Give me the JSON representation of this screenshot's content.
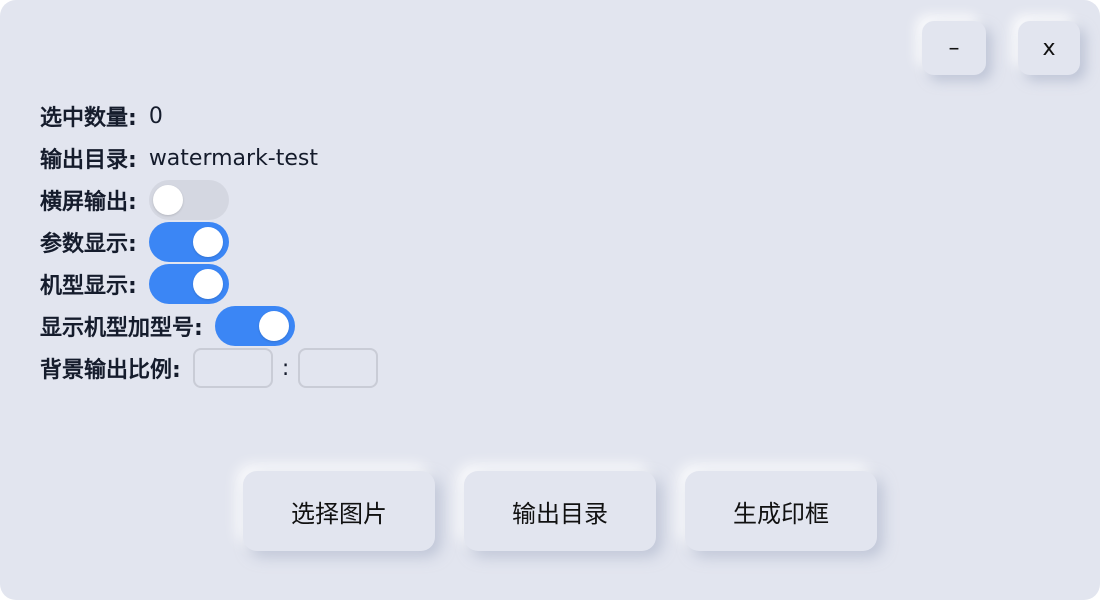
{
  "window_controls": {
    "minimize_label": "–",
    "close_label": "x"
  },
  "settings": {
    "selected_count": {
      "label": "选中数量:",
      "value": "0"
    },
    "output_dir": {
      "label": "输出目录:",
      "value": "watermark-test"
    },
    "landscape_output": {
      "label": "横屏输出:",
      "enabled": false
    },
    "show_params": {
      "label": "参数显示:",
      "enabled": true
    },
    "show_model": {
      "label": "机型显示:",
      "enabled": true
    },
    "show_model_with_type": {
      "label": "显示机型加型号:",
      "enabled": true
    },
    "bg_ratio": {
      "label": "背景输出比例:",
      "separator": ":",
      "width_value": "",
      "height_value": ""
    }
  },
  "actions": {
    "select_images": "选择图片",
    "output_directory": "输出目录",
    "generate_frame": "生成印框"
  },
  "colors": {
    "background": "#e2e5ef",
    "toggle_on": "#3b86f5",
    "toggle_off": "#d4d7e1"
  }
}
